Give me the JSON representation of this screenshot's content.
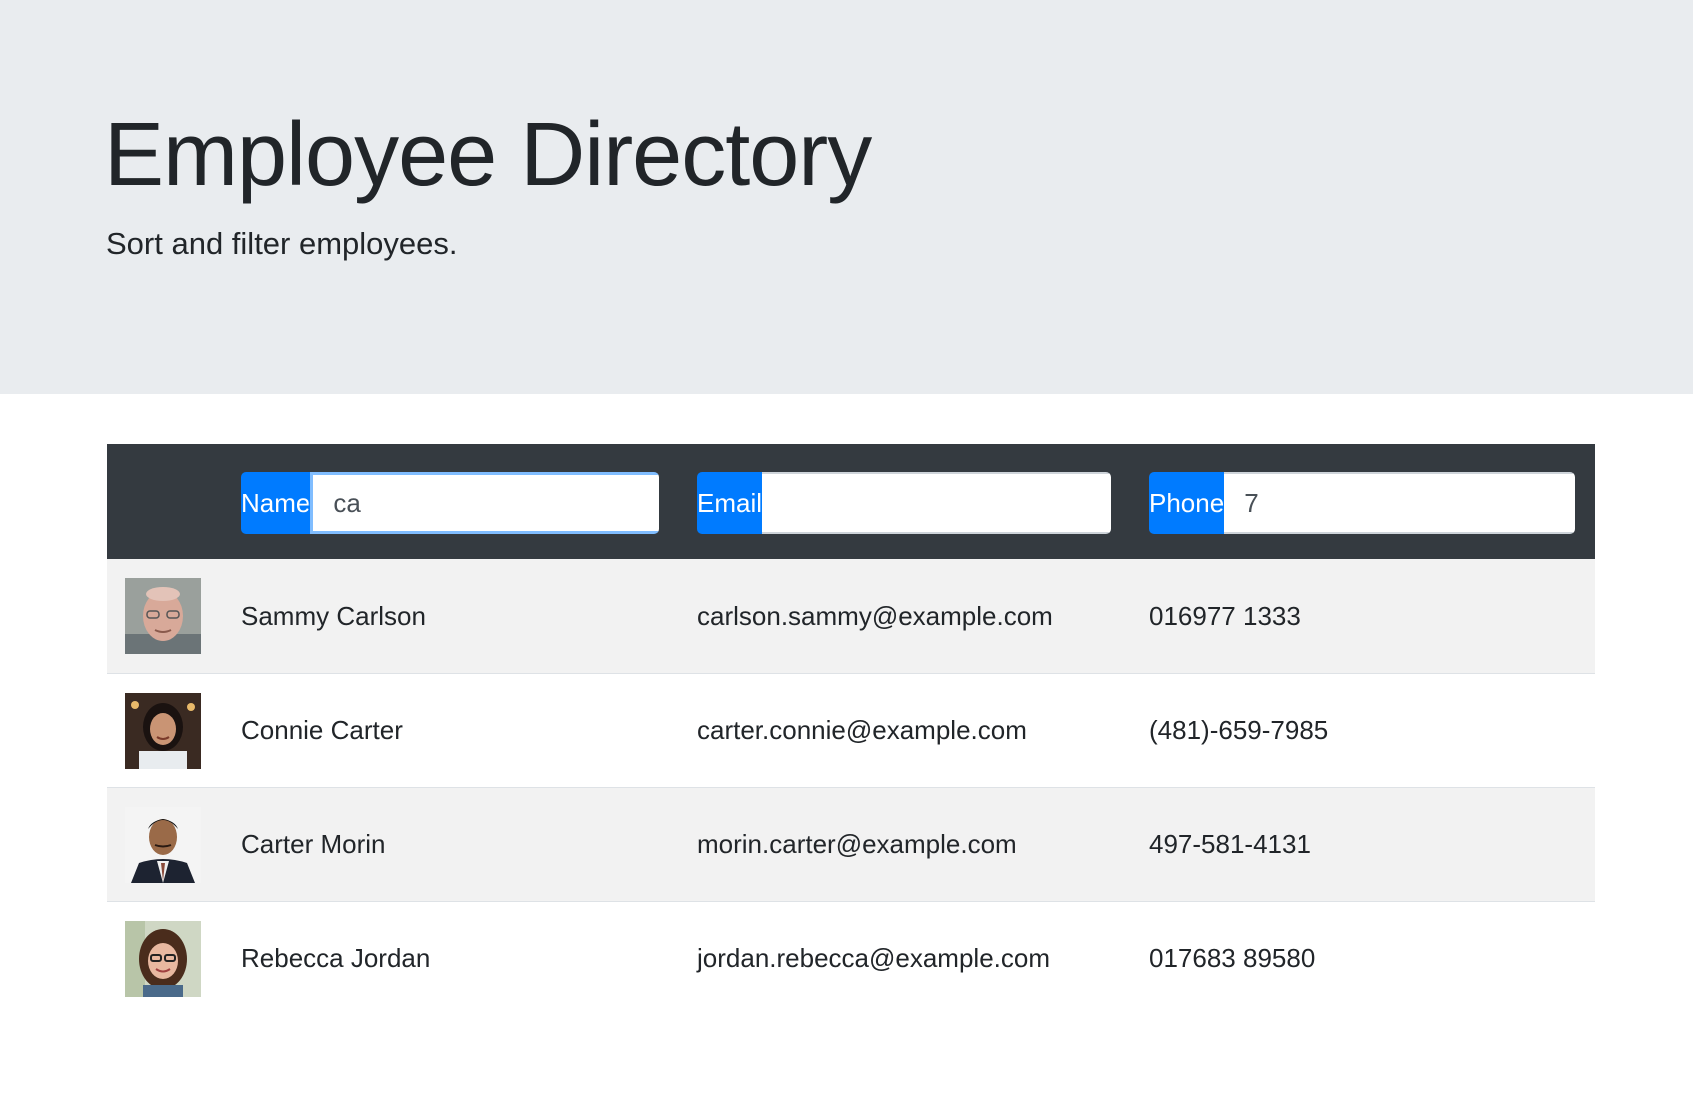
{
  "header": {
    "title": "Employee Directory",
    "subtitle": "Sort and filter employees."
  },
  "filters": {
    "name": {
      "label": "Name",
      "value": "ca",
      "placeholder": ""
    },
    "email": {
      "label": "Email",
      "value": "",
      "placeholder": ""
    },
    "phone": {
      "label": "Phone",
      "value": "7",
      "placeholder": ""
    }
  },
  "employees": [
    {
      "name": "Sammy Carlson",
      "email": "carlson.sammy@example.com",
      "phone": "016977 1333",
      "avatar": "avatar-photo"
    },
    {
      "name": "Connie Carter",
      "email": "carter.connie@example.com",
      "phone": "(481)-659-7985",
      "avatar": "avatar-photo"
    },
    {
      "name": "Carter Morin",
      "email": "morin.carter@example.com",
      "phone": "497-581-4131",
      "avatar": "avatar-photo"
    },
    {
      "name": "Rebecca Jordan",
      "email": "jordan.rebecca@example.com",
      "phone": "017683 89580",
      "avatar": "avatar-photo"
    }
  ],
  "colors": {
    "jumbotron_bg": "#e9ecef",
    "table_header_bg": "#343a40",
    "accent": "#007bff",
    "stripe": "#f2f2f2"
  }
}
